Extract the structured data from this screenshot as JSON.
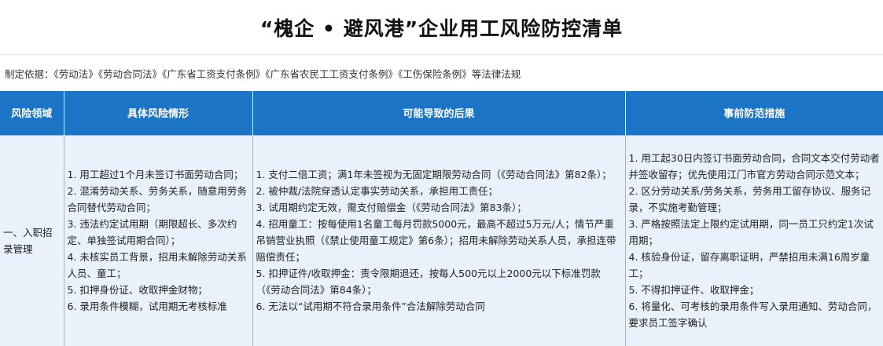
{
  "title": "“槐企 • 避风港”企业用工风险防控清单",
  "basis": "制定依据：《劳动法》《劳动合同法》《广东省工资支付条例》《广东省农民工工资支付条例》《工伤保险条例》等法律法规",
  "columns": [
    "风险领域",
    "具体风险情形",
    "可能导致的后果",
    "事前防范措施"
  ],
  "rows": [
    {
      "area": "一、入职招录管理",
      "risks": [
        "1. 用工超过1个月未签订书面劳动合同；",
        "2. 混淆劳动关系、劳务关系，随意用劳务合同替代劳动合同；",
        "3. 违法约定试用期（期限超长、多次约定、单独签试用期合同）；",
        "4. 未核实员工背景，招用未解除劳动关系人员、童工；",
        "5. 扣押身份证、收取押金财物；",
        "6. 录用条件模糊，试用期无考核标准"
      ],
      "consequences": [
        "1. 支付二倍工资；满1年未签视为无固定期限劳动合同（《劳动合同法》第82条）；",
        "2. 被仲裁/法院穿透认定事实劳动关系，承担用工责任；",
        "3. 试用期约定无效，需支付赔偿金（《劳动合同法》第83条）；",
        "4. 招用童工：按每使用1名童工每月罚款5000元，最高不超过5万元/人；情节严重吊销营业执照（《禁止使用童工规定》第6条）；招用未解除劳动关系人员，承担连带赔偿责任；",
        "5. 扣押证件/收取押金：责令限期退还，按每人500元以上2000元以下标准罚款（《劳动合同法》第84条）；",
        "6. 无法以“试用期不符合录用条件”合法解除劳动合同"
      ],
      "measures": [
        "1. 用工起30日内签订书面劳动合同，合同文本交付劳动者并签收留存；优先使用江门市官方劳动合同示范文本；",
        "2. 区分劳动关系/劳务关系，劳务用工留存协议、服务记录，不实施考勤管理；",
        "3. 严格按照法定上限约定试用期，同一员工只约定1次试用期；",
        "4. 核验身份证，留存离职证明，严禁招用未满16周岁童工；",
        "5. 不得扣押证件、收取押金；",
        "6. 将量化、可考核的录用条件写入录用通知、劳动合同，要求员工签字确认"
      ]
    }
  ]
}
